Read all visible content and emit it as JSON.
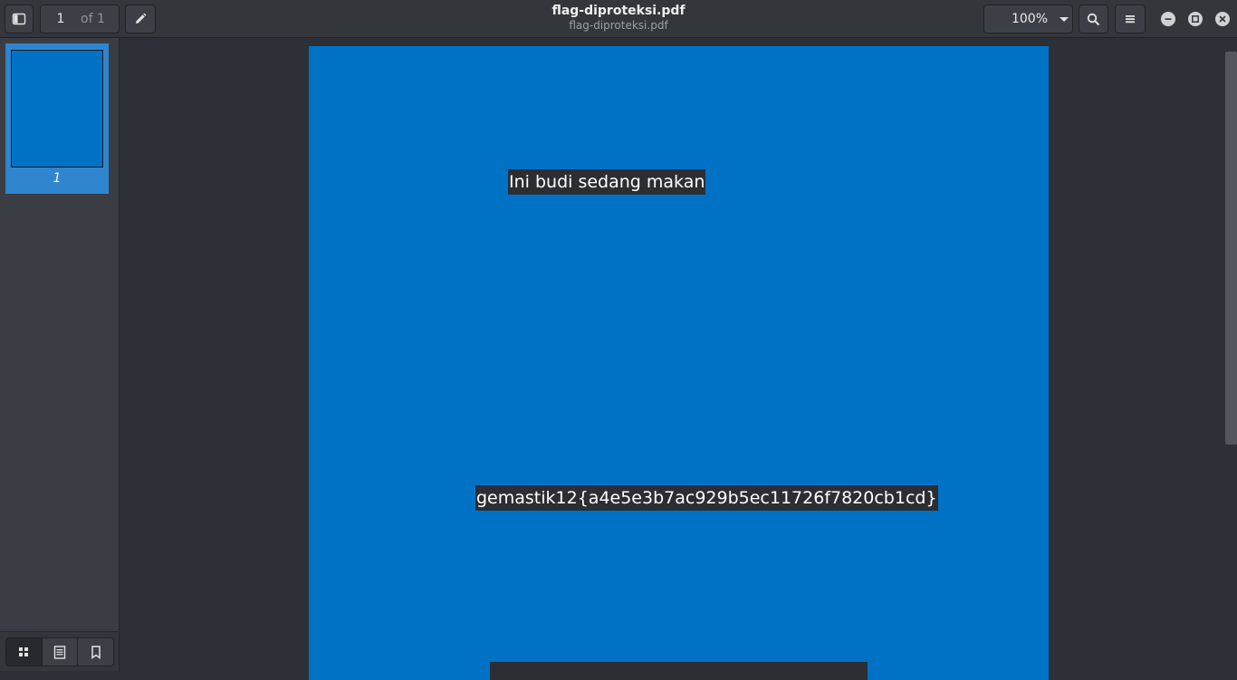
{
  "header": {
    "sidebar_toggle_icon": "sidebar-toggle-icon",
    "page_current": "1",
    "page_of": "of 1",
    "annotate_icon": "pencil-icon",
    "title": "flag-diproteksi.pdf",
    "subtitle": "flag-diproteksi.pdf",
    "zoom_value": "100%",
    "search_icon": "search-icon",
    "menu_icon": "hamburger-menu-icon",
    "window_controls": [
      "minimize-icon",
      "maximize-icon",
      "close-icon"
    ]
  },
  "sidebar": {
    "thumbnails": [
      {
        "label": "1"
      }
    ],
    "footer_tabs": [
      "thumbnails-icon",
      "outline-icon",
      "bookmarks-icon"
    ],
    "active_tab": "thumbnails-icon"
  },
  "document": {
    "page_color": "#0072c6",
    "texts": {
      "line1": "Ini budi sedang makan",
      "flag": "gemastik12{a4e5e3b7ac929b5ec11726f7820cb1cd}"
    }
  },
  "colors": {
    "accent": "#2f86cf",
    "headerbar": "#33373c",
    "background": "#2d3036"
  }
}
